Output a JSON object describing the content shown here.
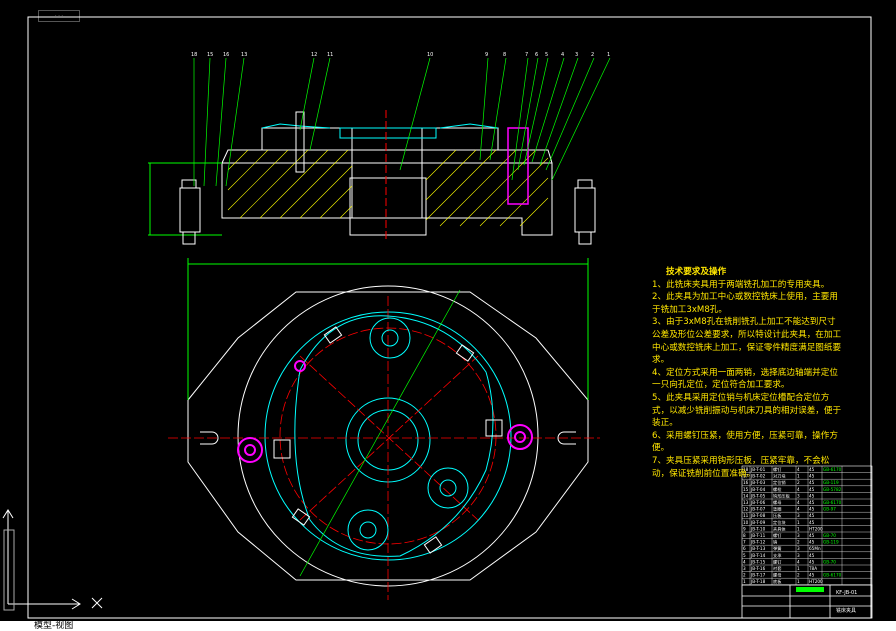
{
  "view_tab": "模型-视图",
  "part_numbers_top": [
    "18",
    "15",
    "16",
    "13",
    "12",
    "11",
    "10",
    "9",
    "8",
    "7",
    "6",
    "5",
    "4",
    "3",
    "2",
    "1"
  ],
  "tech_requirements": {
    "title": "技术要求及操作",
    "lines": [
      "1、此铣床夹具用于两端铣孔加工的专用夹具。",
      "2、此夹具为加工中心或数控铣床上使用，主要用于铣加工3xM8孔。",
      "3、由于3xM8孔在铣削铣孔上加工不能达到尺寸公差及形位公差要求，所以特设计此夹具，在加工中心或数控铣床上加工，保证零件精度满足图纸要求。",
      "4、定位方式采用一面两销，选择底边轴端并定位一只向孔定位，定位符合加工要求。",
      "5、此夹具采用定位销与机床定位槽配合定位方式，以减少铣削振动与机床刀具的相对误差，便于装正。",
      "6、采用螺钉压紧，使用方便，压紧可靠，操作方便。",
      "7、夹具压紧采用钩形压板，压紧牢靠，不会松动，保证铣削前位置准确。"
    ]
  },
  "bom_rows": [
    [
      "18",
      "JB-T-01",
      "螺钉",
      "4",
      "45",
      "GB-6170"
    ],
    [
      "17",
      "JB-T-02",
      "对刀块",
      "1",
      "45",
      ""
    ],
    [
      "16",
      "JB-T-03",
      "定位销",
      "2",
      "45",
      "GB-119"
    ],
    [
      "15",
      "JB-T-04",
      "螺栓",
      "4",
      "45",
      "GB-5782"
    ],
    [
      "14",
      "JB-T-05",
      "钩形压板",
      "3",
      "45",
      ""
    ],
    [
      "13",
      "JB-T-06",
      "螺母",
      "4",
      "45",
      "GB-6170"
    ],
    [
      "12",
      "JB-T-07",
      "垫圈",
      "4",
      "45",
      "GB-97"
    ],
    [
      "11",
      "JB-T-08",
      "压板",
      "3",
      "45",
      ""
    ],
    [
      "10",
      "JB-T-09",
      "定位块",
      "1",
      "45",
      ""
    ],
    [
      "9",
      "JB-T-10",
      "夹具体",
      "1",
      "HT200",
      ""
    ],
    [
      "8",
      "JB-T-11",
      "螺钉",
      "3",
      "45",
      "GB-70"
    ],
    [
      "7",
      "JB-T-12",
      "销",
      "2",
      "45",
      "GB-119"
    ],
    [
      "6",
      "JB-T-13",
      "弹簧",
      "3",
      "65Mn",
      ""
    ],
    [
      "5",
      "JB-T-14",
      "支承",
      "3",
      "45",
      ""
    ],
    [
      "4",
      "JB-T-15",
      "螺钉",
      "4",
      "45",
      "GB-70"
    ],
    [
      "3",
      "JB-T-16",
      "衬套",
      "1",
      "T8A",
      ""
    ],
    [
      "2",
      "JB-T-17",
      "螺母",
      "2",
      "45",
      "GB-6170"
    ],
    [
      "1",
      "JB-T-18",
      "底板",
      "1",
      "HT200",
      ""
    ]
  ],
  "title_block": {
    "drawing_no": "KF-JB-01",
    "name": "铣床夹具"
  },
  "colors": {
    "background": "#000000",
    "outline": "#ffffff",
    "dimension": "#00ff00",
    "center": "#ff0000",
    "hatch": "#ffff00",
    "part": "#00ffff",
    "pin": "#ff00ff"
  }
}
